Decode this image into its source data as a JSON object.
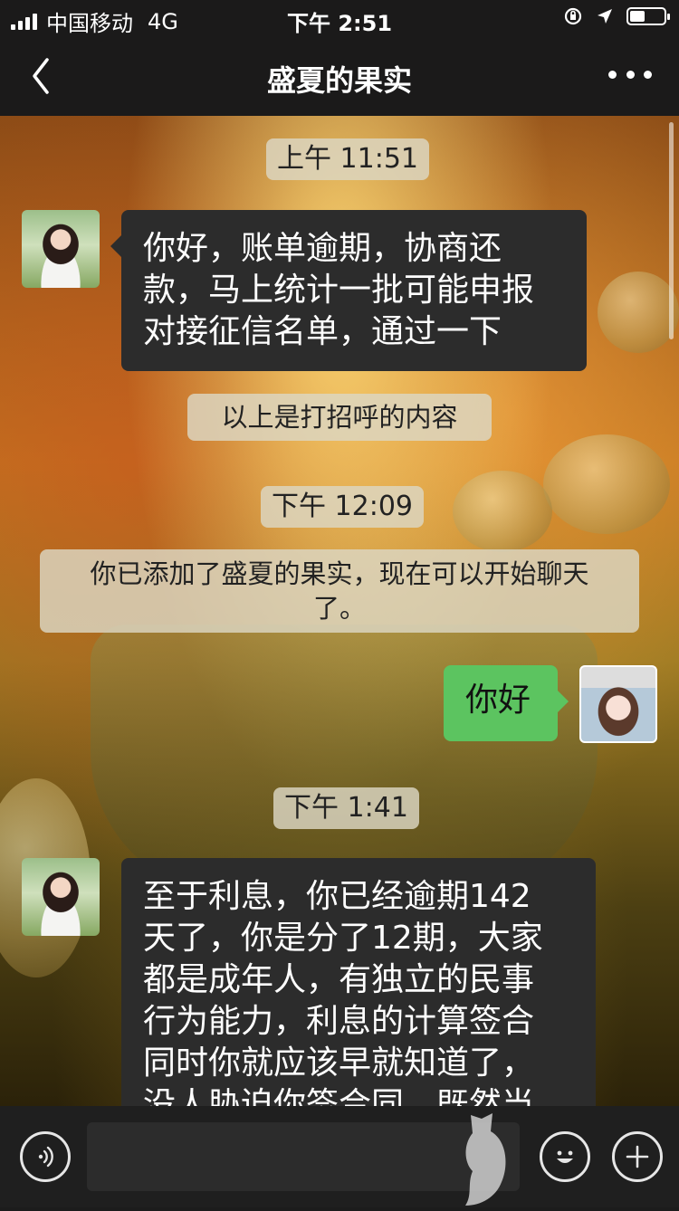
{
  "status_bar": {
    "carrier": "中国移动",
    "network": "4G",
    "time": "下午 2:51"
  },
  "nav": {
    "title": "盛夏的果实"
  },
  "chat": {
    "time_1": "上午 11:51",
    "msg_1_lines": [
      "你好，账单逾期，协商还",
      "款，马上统计一批可能申报",
      "对接征信名单，通过一下"
    ],
    "system_1": "以上是打招呼的内容",
    "time_2": "下午 12:09",
    "system_2_lines": [
      "你已添加了盛夏的果实，现在可以开始聊天",
      "了。"
    ],
    "msg_2": "你好",
    "time_3": "下午 1:41",
    "msg_3_lines": [
      "至于利息，你已经逾期142",
      "天了，你是分了12期，大家",
      "都是成年人，有独立的民事",
      "行为能力，利息的计算签合",
      "同时你就应该早就知道了，",
      "没人胁迫你签合同，既然当"
    ]
  },
  "input": {
    "value": "",
    "placeholder": ""
  },
  "icons": {
    "voice": "voice-icon",
    "emoji": "emoji-icon",
    "plus": "plus-icon",
    "back": "back-chevron-icon",
    "more": "more-icon"
  }
}
